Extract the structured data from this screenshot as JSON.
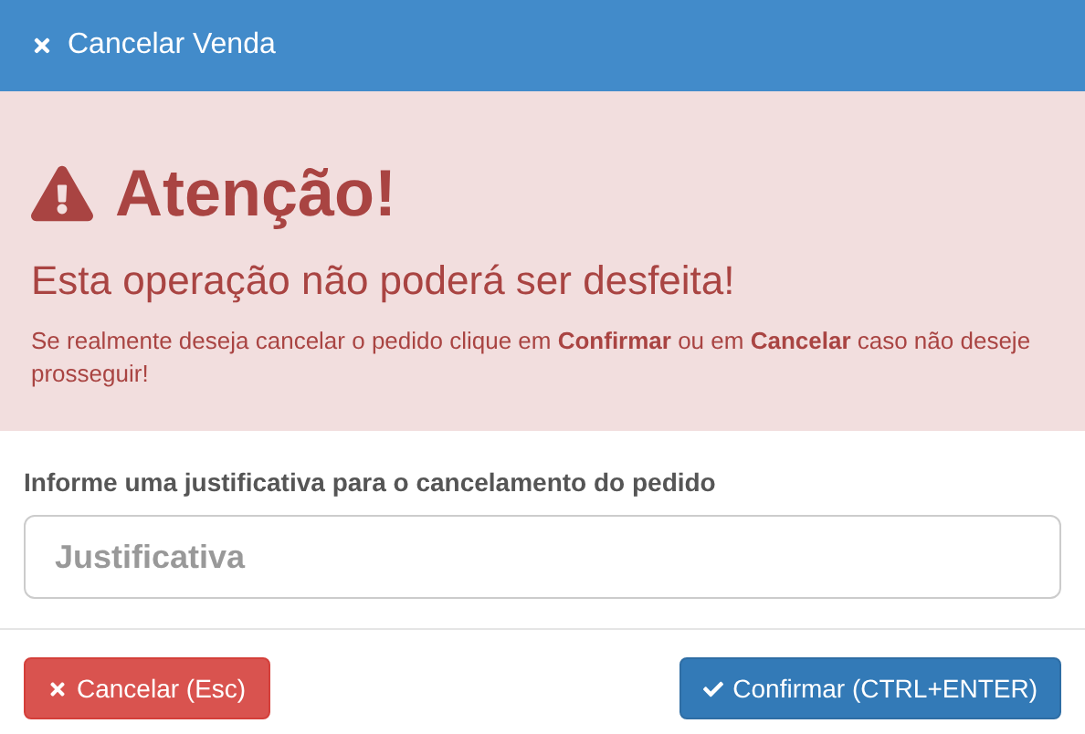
{
  "window": {
    "title": "Cancelar Venda"
  },
  "alert": {
    "heading": "Atenção!",
    "subheading": "Esta operação não poderá ser desfeita!",
    "message": "Se realmente deseja cancelar o pedido clique em **Confirmar** ou em **Cancelar** caso não deseje prosseguir!"
  },
  "form": {
    "label": "Informe uma justificativa para o cancelamento do pedido",
    "placeholder": "Justificativa"
  },
  "buttons": [
    {
      "label": "Cancelar (Esc)",
      "kind": "cancel"
    },
    {
      "label": "Confirmar (CTRL+ENTER)",
      "kind": "confirm"
    }
  ]
}
